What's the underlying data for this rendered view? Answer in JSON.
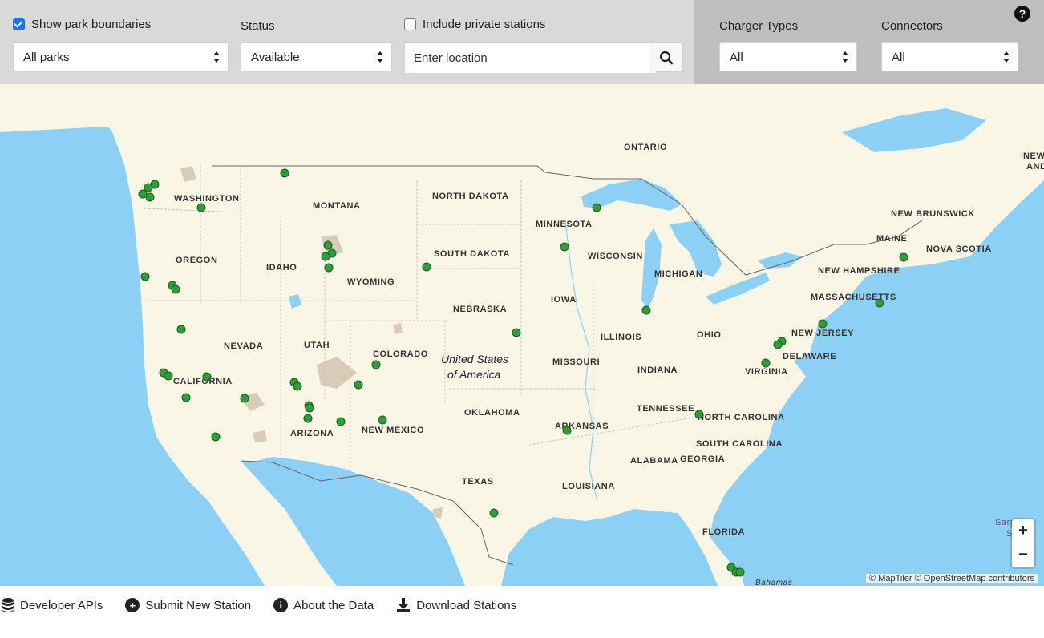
{
  "filters": {
    "show_park_boundaries": {
      "label": "Show park boundaries",
      "checked": true
    },
    "parks_select": {
      "value": "All parks"
    },
    "status": {
      "label": "Status",
      "value": "Available"
    },
    "include_private": {
      "label": "Include private stations",
      "checked": false
    },
    "location": {
      "placeholder": "Enter location",
      "search_icon": "search-icon"
    },
    "charger_types": {
      "label": "Charger Types",
      "value": "All"
    },
    "connectors": {
      "label": "Connectors",
      "value": "All"
    },
    "help_icon": "question-circle-icon"
  },
  "map": {
    "country_label_line1": "United States",
    "country_label_line2": "of America",
    "region_labels": {
      "ontario": "ONTARIO",
      "washington": "WASHINGTON",
      "montana": "MONTANA",
      "north_dakota": "NORTH DAKOTA",
      "minnesota": "MINNESOTA",
      "new_brunswick": "NEW BRUNSWICK",
      "maine": "MAINE",
      "nova_scotia": "NOVA SCOTIA",
      "oregon": "OREGON",
      "idaho": "IDAHO",
      "wyoming": "WYOMING",
      "south_dakota": "SOUTH DAKOTA",
      "wisconsin": "WISCONSIN",
      "michigan": "MICHIGAN",
      "new_hampshire": "NEW HAMPSHIRE",
      "massachusetts": "MASSACHUSETTS",
      "nebraska": "NEBRASKA",
      "iowa": "IOWA",
      "nevada": "NEVADA",
      "utah": "UTAH",
      "colorado": "COLORADO",
      "illinois": "ILLINOIS",
      "ohio": "OHIO",
      "new_jersey": "NEW JERSEY",
      "delaware": "DELAWARE",
      "missouri": "MISSOURI",
      "indiana": "INDIANA",
      "virginia": "VIRGINIA",
      "california": "CALIFORNIA",
      "oklahoma": "OKLAHOMA",
      "tennessee": "TENNESSEE",
      "north_carolina": "NORTH CAROLINA",
      "arizona": "ARIZONA",
      "new_mexico": "NEW MEXICO",
      "arkansas": "ARKANSAS",
      "south_carolina": "SOUTH CAROLINA",
      "alabama": "ALABAMA",
      "georgia": "GEORGIA",
      "texas": "TEXAS",
      "louisiana": "LOUISIANA",
      "florida": "FLORIDA",
      "bahamas": "Bahamas",
      "edge_new": "NEW",
      "edge_and": "AND",
      "edge_sarg": "Sarg",
      "edge_s": "S"
    },
    "zoom_in": "+",
    "zoom_out": "−",
    "attribution": "© MapTiler © OpenStreetMap contributors",
    "colors": {
      "water": "#8dd0f5",
      "land": "#faf6e6",
      "park": "#d8cbb8",
      "station": "#2e9e3a",
      "station_border": "#1d5c24"
    }
  },
  "footer": {
    "links": [
      {
        "label": "Developer APIs",
        "icon": "database-icon"
      },
      {
        "label": "Submit New Station",
        "icon": "plus-circle-icon"
      },
      {
        "label": "About the Data",
        "icon": "info-circle-icon"
      },
      {
        "label": "Download Stations",
        "icon": "download-icon"
      }
    ]
  }
}
